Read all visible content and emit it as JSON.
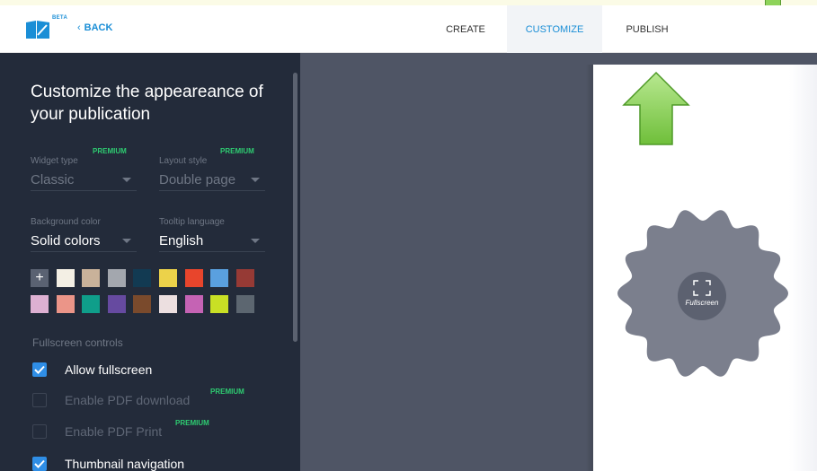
{
  "header": {
    "logo_icon": "publication-logo-icon",
    "beta_badge": "BETA",
    "back_label": "BACK",
    "tabs": [
      {
        "label": "CREATE",
        "active": false
      },
      {
        "label": "CUSTOMIZE",
        "active": true
      },
      {
        "label": "PUBLISH",
        "active": false
      }
    ],
    "accent_color": "#1a8ed6"
  },
  "sidebar": {
    "title": "Customize the appeareance of your publication",
    "widget_type": {
      "label": "Widget type",
      "premium": "PREMIUM",
      "value": "Classic"
    },
    "layout_style": {
      "label": "Layout style",
      "premium": "PREMIUM",
      "value": "Double page"
    },
    "background_color": {
      "label": "Background color",
      "value": "Solid colors"
    },
    "tooltip_language": {
      "label": "Tooltip language",
      "value": "English"
    },
    "add_swatch_label": "+",
    "swatches": [
      "#f3efe4",
      "#c9b29a",
      "#a3a7ae",
      "#123a52",
      "#ecd24a",
      "#e8452c",
      "#5aa0df",
      "#963a35",
      "#ddb0d2",
      "#eb9588",
      "#0f9e8a",
      "#664aa0",
      "#7a4a2c",
      "#ecdfe0",
      "#c563b4",
      "#c9e025",
      "#5c6670"
    ],
    "fullscreen_section_label": "Fullscreen controls",
    "options": [
      {
        "label": "Allow fullscreen",
        "checked": true,
        "premium": ""
      },
      {
        "label": "Enable PDF download",
        "checked": false,
        "premium": "PREMIUM"
      },
      {
        "label": "Enable PDF Print",
        "checked": false,
        "premium": "PREMIUM"
      },
      {
        "label": "Thumbnail navigation",
        "checked": true,
        "premium": ""
      }
    ],
    "premium_color": "#2ecc71"
  },
  "preview": {
    "fullscreen_label": "Fullscreen",
    "fullscreen_icon": "fullscreen-expand-icon",
    "pointer_arrow_icon": "green-up-arrow-icon",
    "background_color": "#4f5565"
  }
}
